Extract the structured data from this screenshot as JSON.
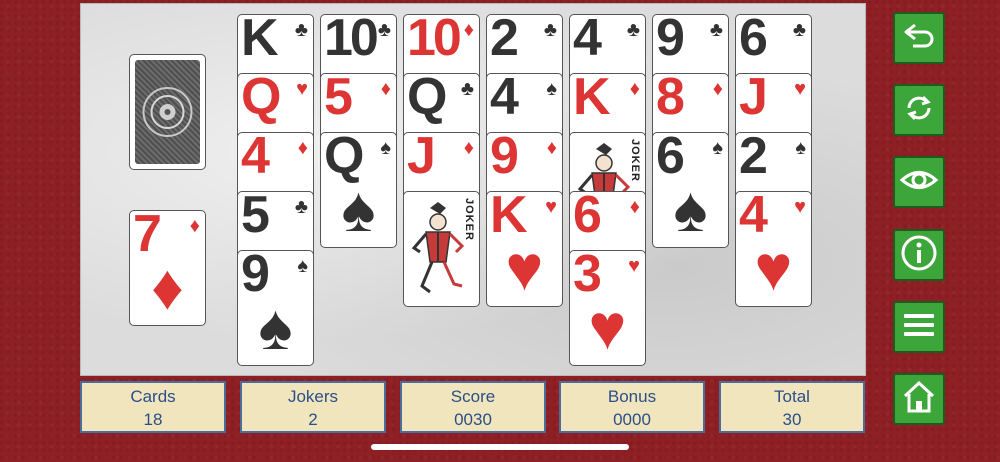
{
  "stats": [
    {
      "label": "Cards",
      "value": "18"
    },
    {
      "label": "Jokers",
      "value": "2"
    },
    {
      "label": "Score",
      "value": "0030"
    },
    {
      "label": "Bonus",
      "value": "0000"
    },
    {
      "label": "Total",
      "value": "30"
    }
  ],
  "waste_card": {
    "rank": "7",
    "suit": "♦",
    "color": "red"
  },
  "columns": [
    [
      {
        "rank": "K",
        "suit": "♣",
        "color": "black"
      },
      {
        "rank": "Q",
        "suit": "♥",
        "color": "red"
      },
      {
        "rank": "4",
        "suit": "♦",
        "color": "red"
      },
      {
        "rank": "5",
        "suit": "♣",
        "color": "black"
      },
      {
        "rank": "9",
        "suit": "♠",
        "color": "black"
      }
    ],
    [
      {
        "rank": "10",
        "suit": "♣",
        "color": "black"
      },
      {
        "rank": "5",
        "suit": "♦",
        "color": "red"
      },
      {
        "rank": "Q",
        "suit": "♠",
        "color": "black"
      }
    ],
    [
      {
        "rank": "10",
        "suit": "♦",
        "color": "red"
      },
      {
        "rank": "Q",
        "suit": "♣",
        "color": "black"
      },
      {
        "rank": "J",
        "suit": "♦",
        "color": "red"
      },
      {
        "joker": true,
        "label": "JOKER"
      }
    ],
    [
      {
        "rank": "2",
        "suit": "♣",
        "color": "black"
      },
      {
        "rank": "4",
        "suit": "♠",
        "color": "black"
      },
      {
        "rank": "9",
        "suit": "♦",
        "color": "red"
      },
      {
        "rank": "K",
        "suit": "♥",
        "color": "red"
      }
    ],
    [
      {
        "rank": "4",
        "suit": "♣",
        "color": "black"
      },
      {
        "rank": "K",
        "suit": "♦",
        "color": "red"
      },
      {
        "joker": true,
        "label": "JOKER"
      },
      {
        "rank": "6",
        "suit": "♦",
        "color": "red"
      },
      {
        "rank": "3",
        "suit": "♥",
        "color": "red"
      }
    ],
    [
      {
        "rank": "9",
        "suit": "♣",
        "color": "black"
      },
      {
        "rank": "8",
        "suit": "♦",
        "color": "red"
      },
      {
        "rank": "6",
        "suit": "♠",
        "color": "black"
      }
    ],
    [
      {
        "rank": "6",
        "suit": "♣",
        "color": "black"
      },
      {
        "rank": "J",
        "suit": "♥",
        "color": "red"
      },
      {
        "rank": "2",
        "suit": "♠",
        "color": "black"
      },
      {
        "rank": "4",
        "suit": "♥",
        "color": "red"
      }
    ]
  ],
  "controls": [
    {
      "name": "undo-icon"
    },
    {
      "name": "restart-icon"
    },
    {
      "name": "eye-icon"
    },
    {
      "name": "info-icon"
    },
    {
      "name": "menu-icon"
    },
    {
      "name": "home-icon"
    }
  ],
  "colors": {
    "red_suit": "#dd3434",
    "black_suit": "#333333",
    "felt": "#8e1f24",
    "button_green": "#3da63a",
    "panel_text": "#2a4f8a"
  }
}
